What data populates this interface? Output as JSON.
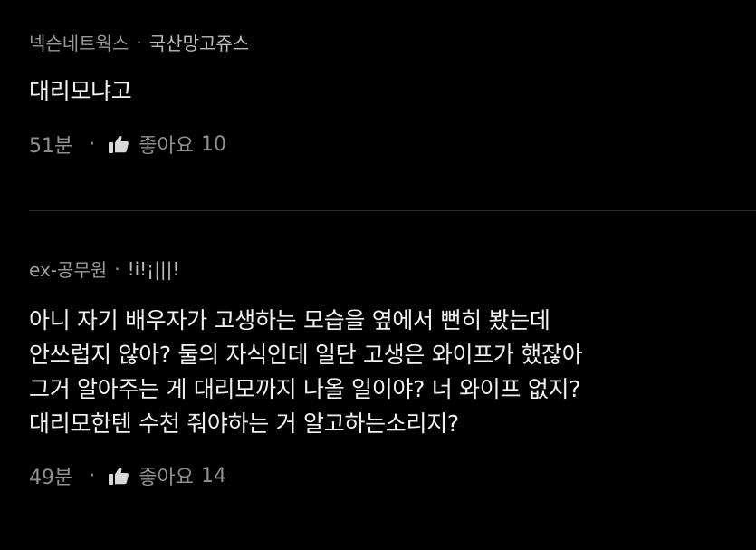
{
  "comments": [
    {
      "author": "넥슨네트웍스",
      "company": "국산망고쥬스",
      "separator": "·",
      "text_lines": [
        "대리모냐고"
      ],
      "time": "51분",
      "footer_separator": "·",
      "like_icon": "thumbs-up-icon",
      "like_label": "좋아요",
      "like_count": "10"
    },
    {
      "author": "ex-공무원",
      "company": "!i!¡|||!",
      "separator": "·",
      "text_lines": [
        "아니 자기 배우자가 고생하는 모습을 옆에서 뻔히 봤는데",
        "안쓰럽지 않아? 둘의 자식인데 일단 고생은 와이프가 했잖아",
        "그거 알아주는 게 대리모까지 나올 일이야? 너 와이프 없지?",
        "대리모한텐 수천 줘야하는 거 알고하는소리지?"
      ],
      "time": "49분",
      "footer_separator": "·",
      "like_icon": "thumbs-up-icon",
      "like_label": "좋아요",
      "like_count": "14"
    }
  ],
  "colors": {
    "background": "#000000",
    "text": "#f2f2f2",
    "meta": "#9a9a9a",
    "divider": "#2b2b2b"
  }
}
